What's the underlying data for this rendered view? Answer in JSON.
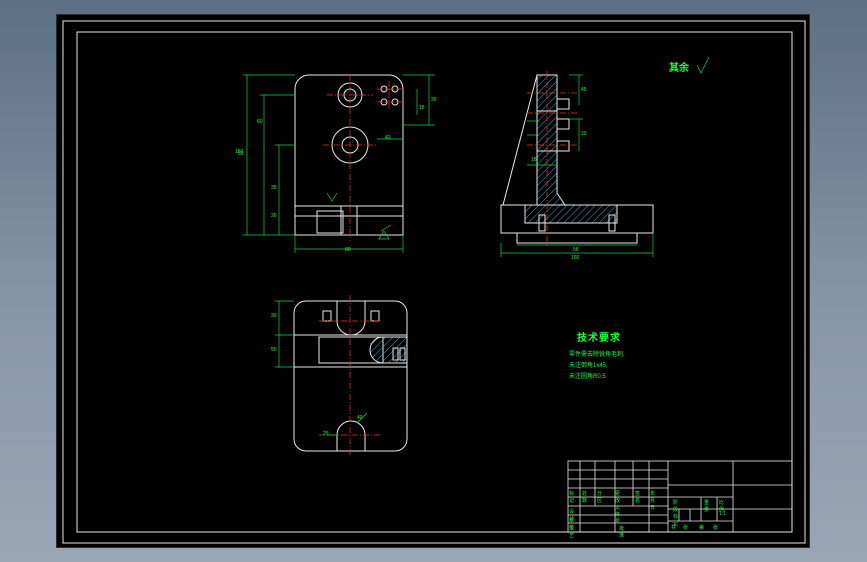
{
  "drawing": {
    "roughness_note": "其余",
    "tech_requirements": {
      "title": "技术要求",
      "lines": [
        "零件需去除锐角毛刺,",
        "未注倒角1x45,",
        "未注圆角R0.5"
      ]
    },
    "dimension_labels": [
      "60",
      "50",
      "35",
      "26",
      "150",
      "30",
      "18",
      "80",
      "40",
      "45",
      "10",
      "58",
      "18",
      "30",
      "50",
      "160",
      "40",
      "25"
    ],
    "title_block": {
      "row_labels": [
        "标记",
        "处数",
        "分区",
        "更改文件号",
        "签名",
        "年月日",
        "设计",
        "审核",
        "工艺",
        "批准"
      ],
      "stage_labels": [
        "阶段标记",
        "重量",
        "比例"
      ],
      "scale": "1:1",
      "sheet_labels": [
        "共",
        "张",
        "第",
        "张"
      ]
    }
  },
  "colors": {
    "canvas": "#000000",
    "geometry": "#e8e8e8",
    "dimension": "#00d84a",
    "centerline": "#ff2b2b",
    "text": "#1bff3a"
  }
}
